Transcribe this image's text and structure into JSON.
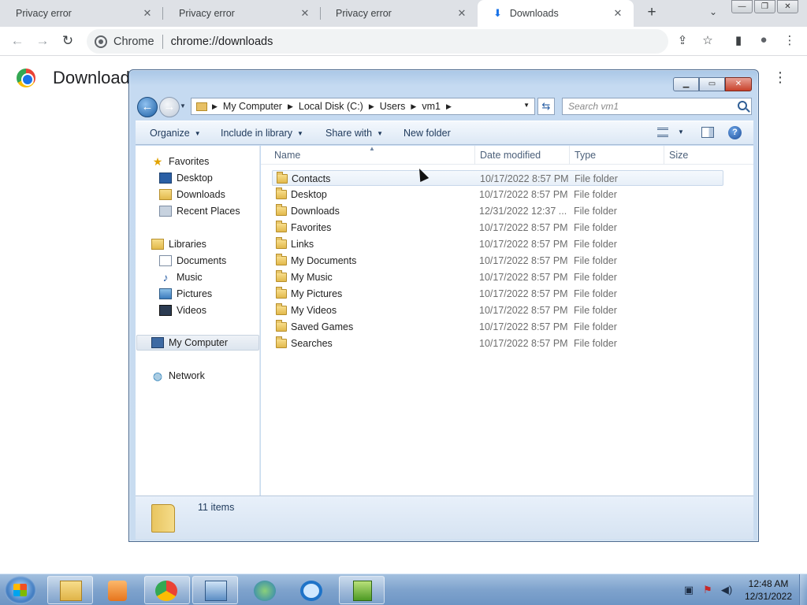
{
  "browser": {
    "tabs": [
      {
        "title": "Privacy error",
        "close": "✕"
      },
      {
        "title": "Privacy error",
        "close": "✕"
      },
      {
        "title": "Privacy error",
        "close": "✕"
      },
      {
        "title": "Downloads",
        "close": "✕"
      }
    ],
    "new_tab": "+",
    "tab_search": "⌄",
    "window_buttons": {
      "minimize": "—",
      "restore": "❐",
      "close": "✕"
    },
    "nav": {
      "back": "←",
      "forward": "→",
      "reload": "↻"
    },
    "omnibox": {
      "chip": "Chrome",
      "url": "chrome://downloads"
    },
    "omnibox_actions": {
      "share": "⇪",
      "bookmark": "☆",
      "side_panel": "▮",
      "profile": "●",
      "menu": "⋮"
    },
    "page": {
      "title": "Downloads",
      "menu": "⋮"
    }
  },
  "explorer": {
    "caption_buttons": {
      "minimize": "▁",
      "maximize": "▭",
      "close": "✕"
    },
    "back": "←",
    "forward": "→",
    "breadcrumb": [
      "My Computer",
      "Local Disk (C:)",
      "Users",
      "vm1"
    ],
    "search_placeholder": "Search vm1",
    "commands": {
      "organize": "Organize",
      "include": "Include in library",
      "share": "Share with",
      "new_folder": "New folder"
    },
    "help": "?",
    "nav": {
      "favorites": "Favorites",
      "favorites_items": [
        "Desktop",
        "Downloads",
        "Recent Places"
      ],
      "libraries": "Libraries",
      "libraries_items": [
        "Documents",
        "Music",
        "Pictures",
        "Videos"
      ],
      "computer": "My Computer",
      "network": "Network"
    },
    "columns": {
      "name": "Name",
      "date": "Date modified",
      "type": "Type",
      "size": "Size"
    },
    "files": [
      {
        "name": "Contacts",
        "date": "10/17/2022 8:57 PM",
        "type": "File folder"
      },
      {
        "name": "Desktop",
        "date": "10/17/2022 8:57 PM",
        "type": "File folder"
      },
      {
        "name": "Downloads",
        "date": "12/31/2022 12:37 ...",
        "type": "File folder"
      },
      {
        "name": "Favorites",
        "date": "10/17/2022 8:57 PM",
        "type": "File folder"
      },
      {
        "name": "Links",
        "date": "10/17/2022 8:57 PM",
        "type": "File folder"
      },
      {
        "name": "My Documents",
        "date": "10/17/2022 8:57 PM",
        "type": "File folder"
      },
      {
        "name": "My Music",
        "date": "10/17/2022 8:57 PM",
        "type": "File folder"
      },
      {
        "name": "My Pictures",
        "date": "10/17/2022 8:57 PM",
        "type": "File folder"
      },
      {
        "name": "My Videos",
        "date": "10/17/2022 8:57 PM",
        "type": "File folder"
      },
      {
        "name": "Saved Games",
        "date": "10/17/2022 8:57 PM",
        "type": "File folder"
      },
      {
        "name": "Searches",
        "date": "10/17/2022 8:57 PM",
        "type": "File folder"
      }
    ],
    "status": "11 items"
  },
  "taskbar": {
    "time": "12:48 AM",
    "date": "12/31/2022"
  }
}
